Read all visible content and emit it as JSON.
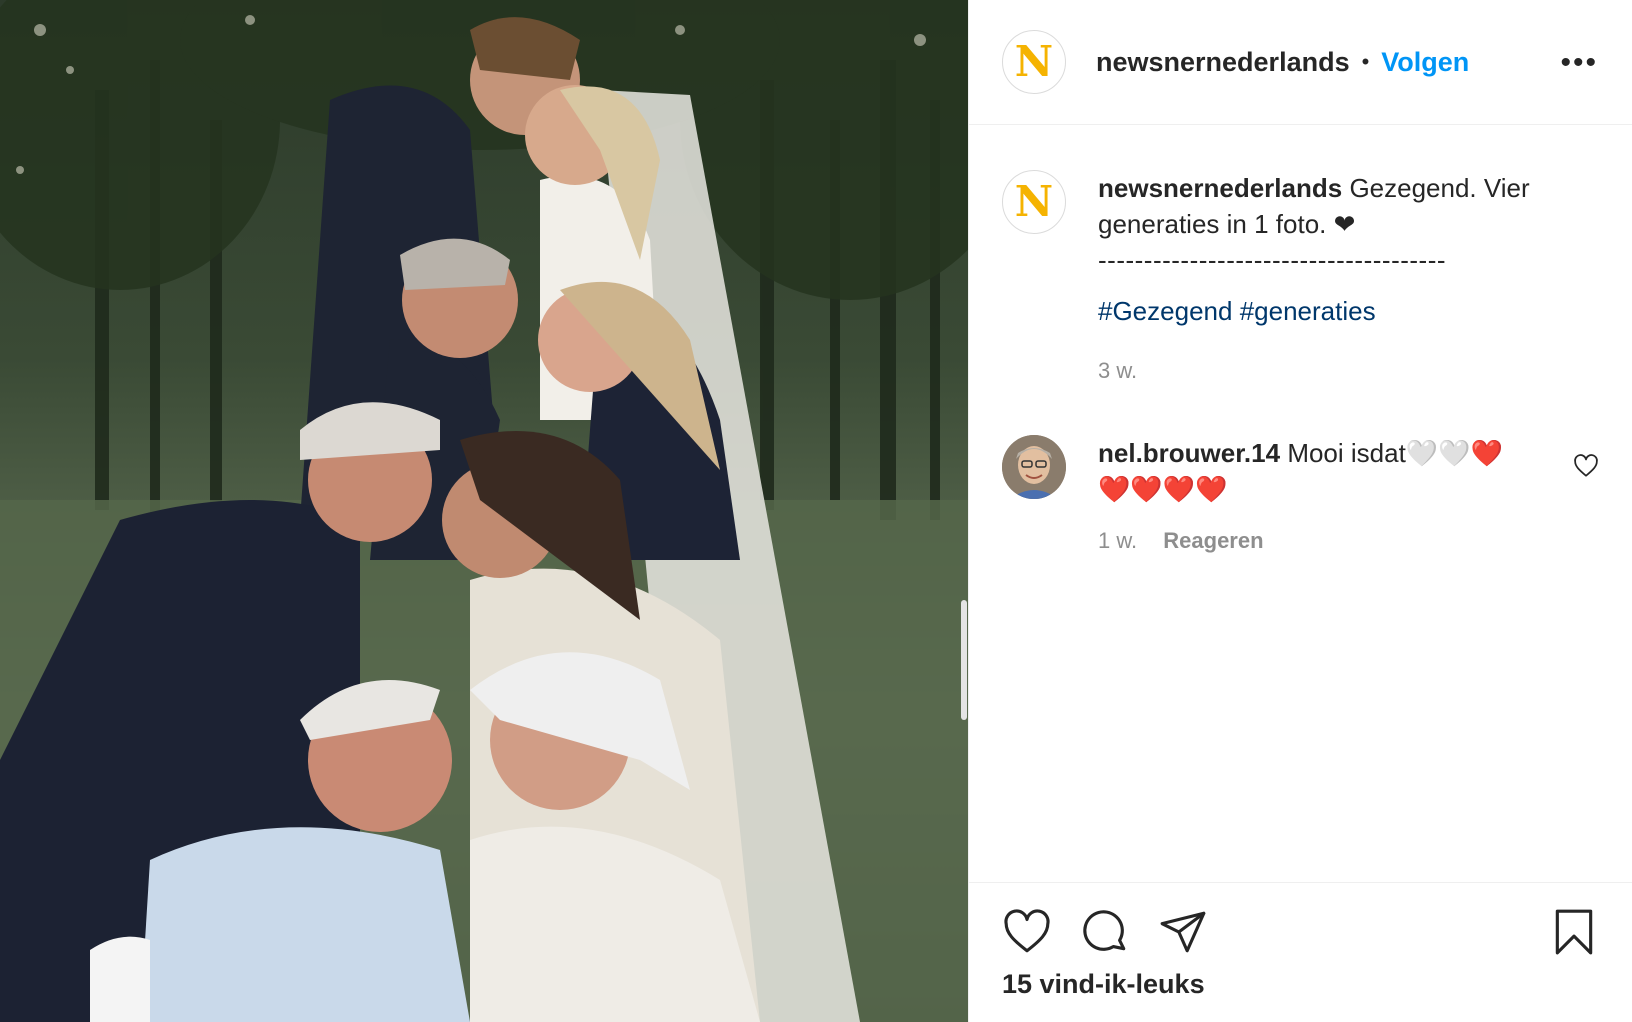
{
  "post": {
    "username": "newsnernederlands",
    "logo_letter": "N",
    "follow_label": "Volgen",
    "more_icon": "more-horizontal-icon",
    "caption": {
      "username": "newsnernederlands",
      "text": "Gezegend. Vier generaties in 1 foto. ❤",
      "divider": "--------------------------------------",
      "hashtags": [
        "#Gezegend",
        "#generaties"
      ],
      "time": "3 w."
    },
    "comments": [
      {
        "username": "nel.brouwer.14",
        "text": "Mooi isdat🤍🤍❤️ ❤️❤️❤️❤️",
        "time": "1 w.",
        "reply_label": "Reageren"
      }
    ],
    "likes_label": "15 vind-ik-leuks",
    "icons": {
      "like": "heart-icon",
      "comment": "comment-icon",
      "share": "share-icon",
      "save": "bookmark-icon"
    },
    "colors": {
      "accent": "#0095f6",
      "logo": "#f5b301",
      "hashtag": "#00376b",
      "muted": "#8e8e8e"
    }
  }
}
